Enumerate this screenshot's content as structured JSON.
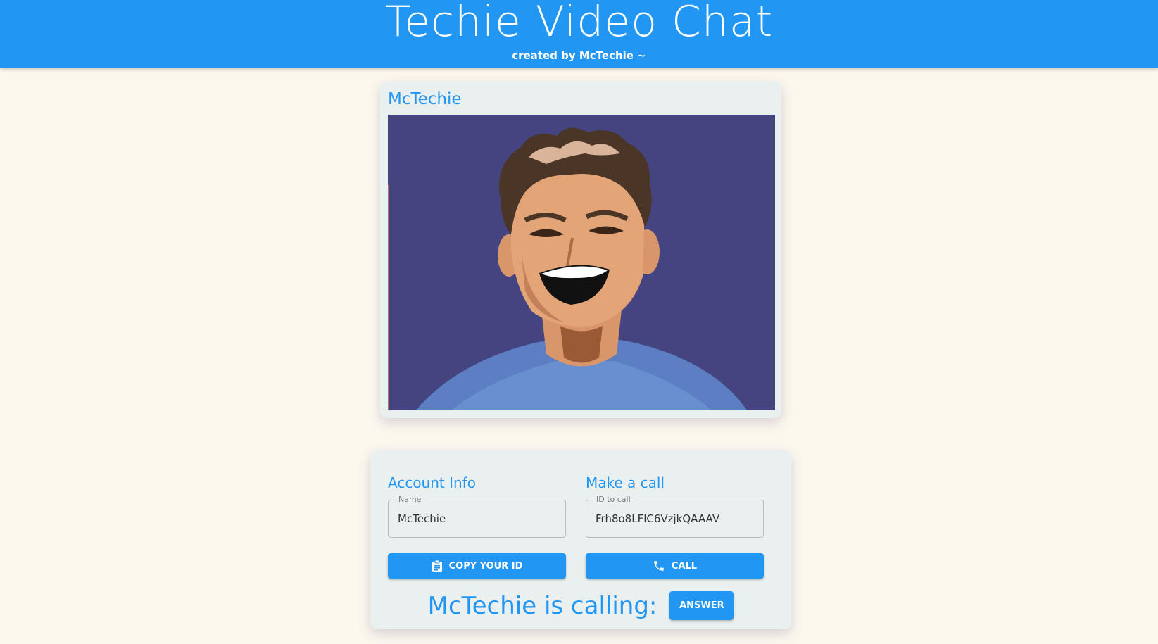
{
  "header": {
    "title": "Techie Video Chat",
    "subtitle": "created by McTechie ~"
  },
  "video": {
    "name": "McTechie"
  },
  "account": {
    "title": "Account Info",
    "name_label": "Name",
    "name_value": "McTechie",
    "copy_button": "Copy Your ID"
  },
  "call": {
    "title": "Make a call",
    "id_label": "ID to call",
    "id_value": "Frh8o8LFlC6VzjkQAAAV",
    "call_button": "Call"
  },
  "incoming": {
    "text": "McTechie is calling:",
    "answer_button": "Answer"
  },
  "colors": {
    "primary": "#2196f3",
    "background": "#fdf8ee",
    "card": "#eaf0f0",
    "video_bg": "#444480"
  }
}
